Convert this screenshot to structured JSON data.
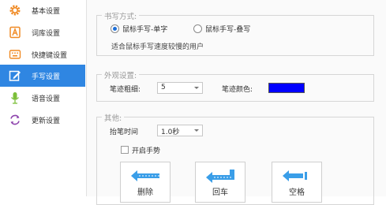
{
  "sidebar": {
    "items": [
      {
        "label": "基本设置",
        "icon": "gear-icon"
      },
      {
        "label": "词库设置",
        "icon": "dictionary-icon"
      },
      {
        "label": "快捷键设置",
        "icon": "keyboard-icon"
      },
      {
        "label": "手写设置",
        "icon": "handwriting-icon",
        "active": true
      },
      {
        "label": "语音设置",
        "icon": "microphone-icon"
      },
      {
        "label": "更新设置",
        "icon": "refresh-icon"
      }
    ]
  },
  "handwriting_mode": {
    "title": "书写方式:",
    "options": [
      "鼠标手写-单字",
      "鼠标手写-叠写"
    ],
    "selected": "鼠标手写-单字",
    "hint": "适合鼠标手写速度较慢的用户"
  },
  "appearance": {
    "title": "外观设置:",
    "stroke_width_label": "笔迹粗细:",
    "stroke_width_value": "5",
    "stroke_color_label": "笔迹颜色:",
    "stroke_color": "#0000ff"
  },
  "other": {
    "title": "其他:",
    "lift_time_label": "抬笔时间",
    "lift_time_value": "1.0秒",
    "gesture_label": "开启手势",
    "gesture_checked": false,
    "gesture_buttons": [
      {
        "label": "删除",
        "icon": "arrow-left-icon"
      },
      {
        "label": "回车",
        "icon": "enter-arrow-icon"
      },
      {
        "label": "空格",
        "icon": "space-arrow-icon"
      }
    ]
  },
  "colors": {
    "accent": "#2f86e2",
    "icon_orange": "#f08a24",
    "icon_green": "#7cbf3a",
    "icon_purple": "#8e44ad",
    "icon_blue_arrow": "#3a9ee8"
  }
}
